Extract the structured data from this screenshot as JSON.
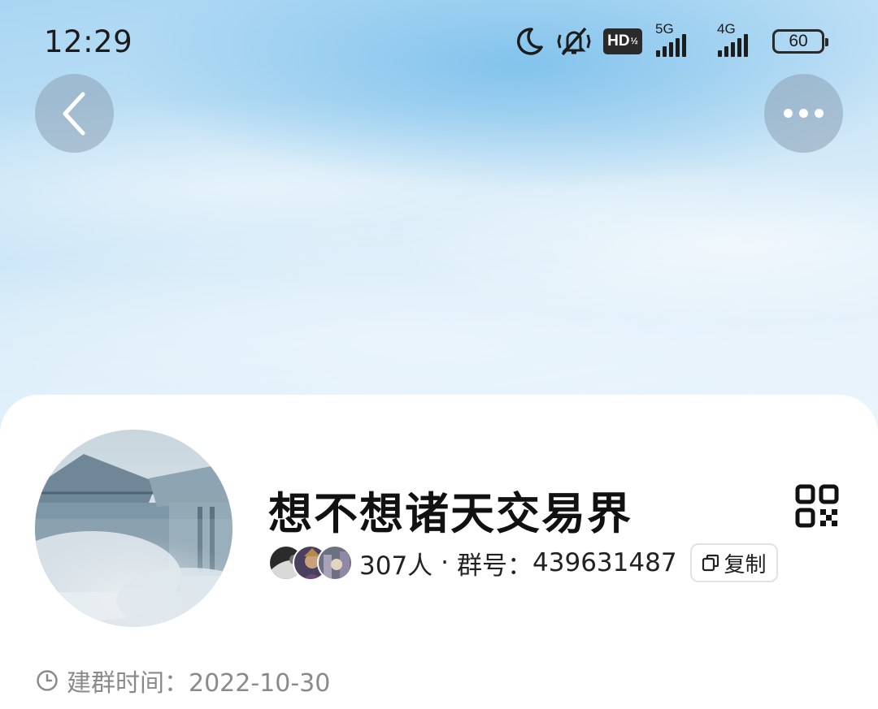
{
  "status_bar": {
    "time": "12:29",
    "icons": [
      "moon-icon",
      "mute-icon",
      "hd-icon",
      "signal-5g-icon",
      "signal-4g-icon",
      "battery-icon"
    ],
    "hd_label": "HD",
    "net1": "5G",
    "net2": "4G",
    "battery": "60"
  },
  "header": {
    "back_icon": "chevron-left-icon",
    "more_icon": "more-icon"
  },
  "group": {
    "name": "想不想诸天交易界",
    "member_count": "307人",
    "separator": "·",
    "number_label": "群号：",
    "number": "439631487",
    "copy_label": "复制",
    "created_label": "建群时间：",
    "created_date": "2022-10-30"
  },
  "colors": {
    "hero_top": "#a9d6f3",
    "hero_bottom": "#eaf4fb",
    "text_primary": "#111111",
    "text_secondary": "#8a8a8a"
  }
}
